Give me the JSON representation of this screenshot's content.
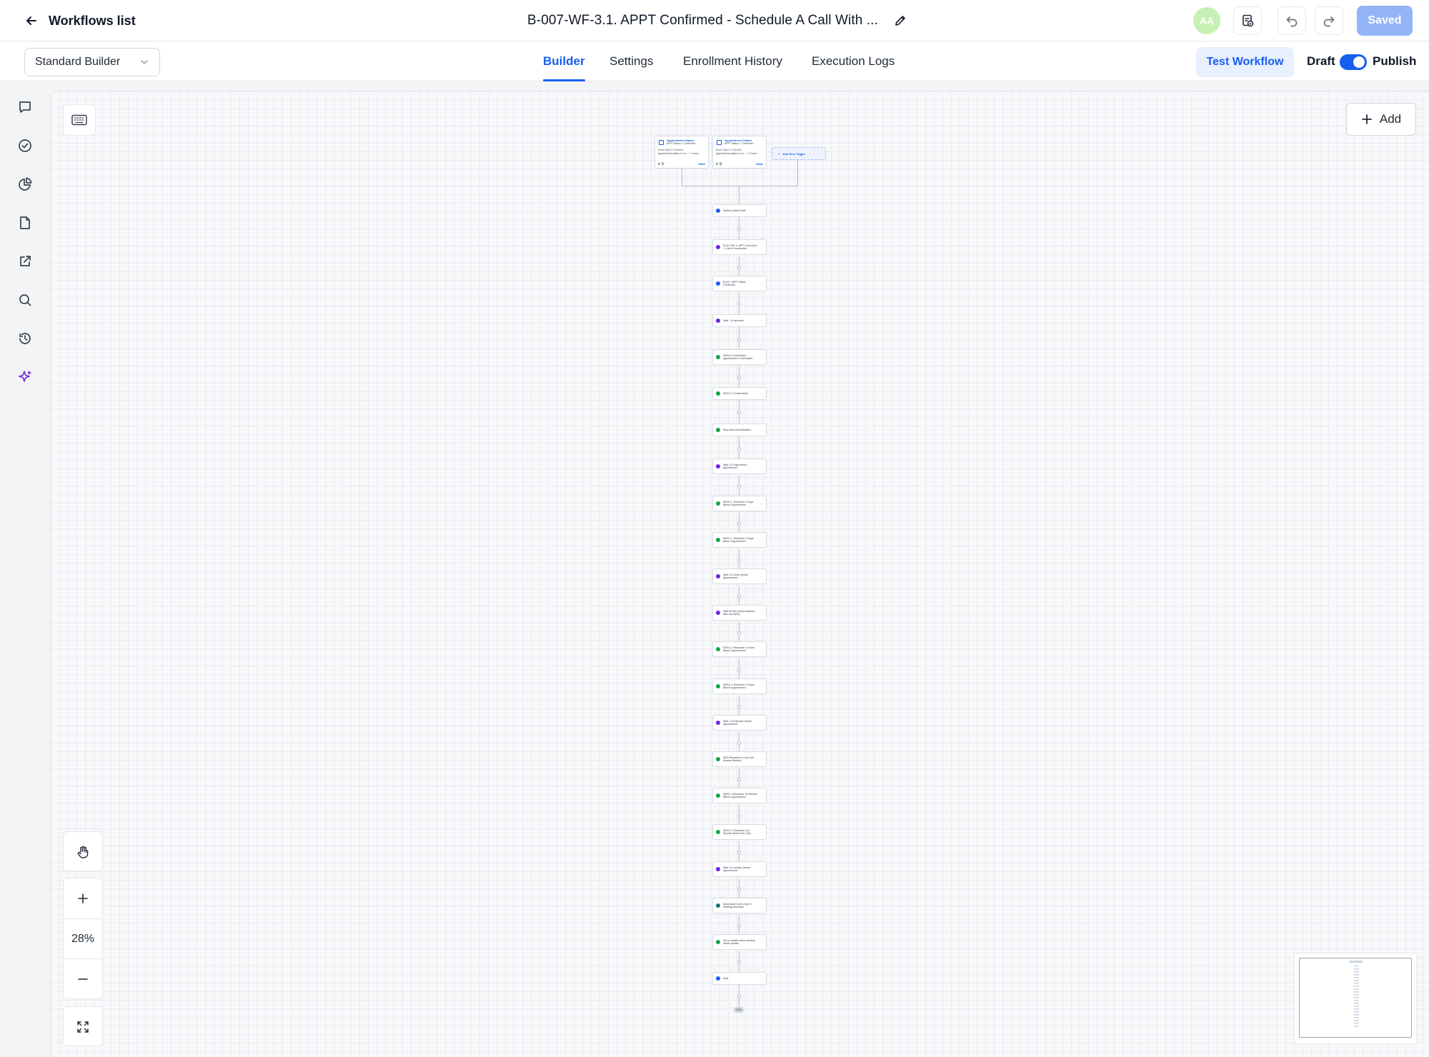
{
  "header": {
    "back_label": "Workflows list",
    "workflow_title": "B-007-WF-3.1. APPT Confirmed - Schedule A Call With ...",
    "avatar_initials": "AA",
    "saved_label": "Saved"
  },
  "subbar": {
    "builder_mode": "Standard Builder",
    "tabs": [
      {
        "label": "Builder"
      },
      {
        "label": "Settings"
      },
      {
        "label": "Enrollment History"
      },
      {
        "label": "Execution Logs"
      }
    ],
    "test_label": "Test Workflow",
    "draft_label": "Draft",
    "publish_label": "Publish"
  },
  "sidebar": {
    "icons": [
      "chat-icon",
      "check-circle-icon",
      "pie-chart-icon",
      "document-icon",
      "external-link-icon",
      "search-icon",
      "history-icon",
      "sparkle-icon"
    ]
  },
  "canvas": {
    "add_label": "Add",
    "zoom": "28%",
    "triggers": [
      {
        "title": "Appointment Status",
        "subtitle": "APPT Status = Confirmed ...",
        "filter": "Event Type is \"Normal\"",
        "filter2": "Appointment status is \"co... + 2 more",
        "stats": "Stats"
      },
      {
        "title": "Appointment Status",
        "subtitle": "APPT Status = Confirmed ...",
        "filter": "Event Type is \"Normal\"",
        "filter2": "Appointment status is \"co... + 2 more",
        "stats": "Stats"
      }
    ],
    "add_trigger_label": "Add New Trigger",
    "end_label": "END",
    "steps": [
      {
        "label": "System Added Note",
        "kind": "blue"
      },
      {
        "label": "B-007-WF-4. APPT Canceled + Call to Reschedule",
        "kind": "purple"
      },
      {
        "label": "B-007: APPT Status Confirmed",
        "kind": "blue"
      },
      {
        "label": "Wait - 10 seconds",
        "kind": "purple"
      },
      {
        "label": "SMS1.0: Scheduled Appointment Confirmation",
        "kind": "green"
      },
      {
        "label": "EMS1.0: Confirmation",
        "kind": "green"
      },
      {
        "label": "Stop Internal Notification",
        "kind": "green"
      },
      {
        "label": "Wait 1-2 Days before Appointment",
        "kind": "purple"
      },
      {
        "label": "EMS1.1: Reminder 2 Days Before Appointment",
        "kind": "green"
      },
      {
        "label": "SMS1.1: Reminder 2 Days Before Appointment",
        "kind": "green"
      },
      {
        "label": "Wait 1-4 Hours before Appointment",
        "kind": "purple"
      },
      {
        "label": "Wait till 8am (Send between 8am and 8pm)",
        "kind": "purple"
      },
      {
        "label": "EMS1.2: Reminder 4 Hours Before Appointment",
        "kind": "green"
      },
      {
        "label": "SMS1.2: Reminder 4 Hours Before Appointment",
        "kind": "green"
      },
      {
        "label": "Wait 1-15 Minutes before Appointment",
        "kind": "purple"
      },
      {
        "label": "SMS Reminder to User (15 Minutes Before)",
        "kind": "green"
      },
      {
        "label": "SMS1.3 Reminder 15 Minutes Before Appointment",
        "kind": "green"
      },
      {
        "label": "EMS1.3: Reminder (15 Minutes Before the Call)",
        "kind": "green"
      },
      {
        "label": "Wait 1-5 minutes before Appointment",
        "kind": "purple"
      },
      {
        "label": "Automated Call to User 1 Meeting Reminder",
        "kind": "teal"
      },
      {
        "label": "S/4 to update client meeting status update",
        "kind": "green"
      },
      {
        "label": "Note",
        "kind": "blue"
      }
    ]
  },
  "colors": {
    "accent": "#155eef",
    "saved_bg": "#93b4f7",
    "avatar_bg": "#c7f0b4",
    "node_blue": "#155eef",
    "node_purple": "#6d28d9",
    "node_green": "#16a34a",
    "node_teal": "#0f766e"
  }
}
